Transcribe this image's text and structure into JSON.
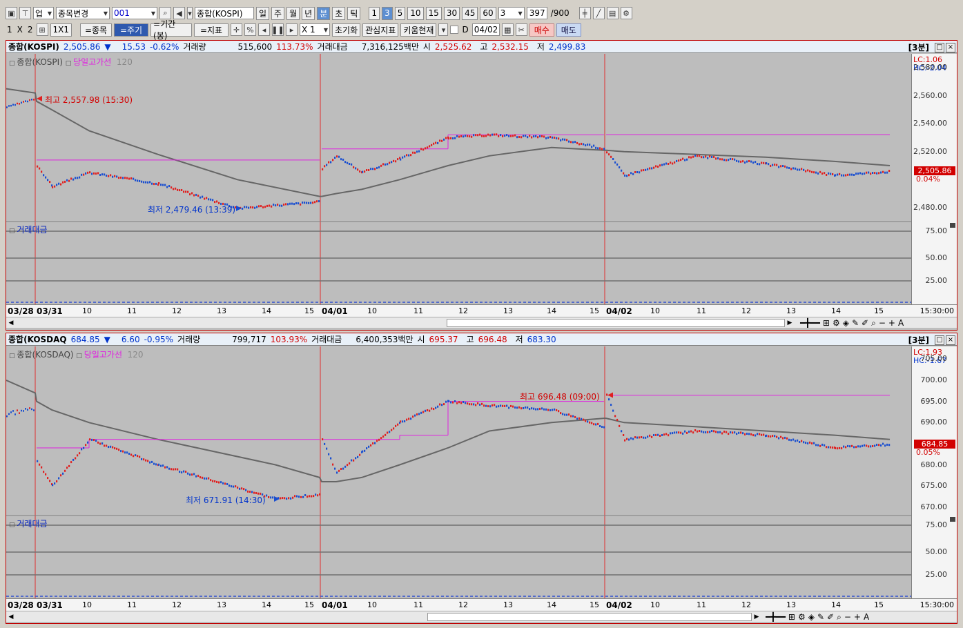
{
  "toolbar1": {
    "market": "업",
    "change_code": "종목변경",
    "code": "001",
    "symbol": "종합(KOSPI)",
    "period_day": "일",
    "period_week": "주",
    "period_month": "월",
    "period_year": "년",
    "period_min": "분",
    "period_sec": "초",
    "period_tick": "틱",
    "intervals": [
      "1",
      "3",
      "5",
      "10",
      "15",
      "30",
      "45",
      "60"
    ],
    "interval_value": "3",
    "count": "397",
    "count_total": "/900"
  },
  "toolbar2": {
    "layout_1": "1",
    "layout_x": "X",
    "layout_2": "2",
    "layout_1x1": "1X1",
    "btn_symbol": "=종목",
    "btn_period": "=주기",
    "btn_range": "=기간(봉)",
    "btn_indicator": "=지표",
    "pct": "%",
    "zoom": "X 1",
    "btn_reset": "초기화",
    "btn_watch": "관심지표",
    "btn_kiwoom": "키움현재",
    "d_label": "D",
    "date": "04/02",
    "btn_buy": "매수",
    "btn_sell": "매도"
  },
  "panels": [
    {
      "name": "종합(KOSPI)",
      "price": "2,505.86",
      "arrow": "▼",
      "change": "15.53",
      "change_pct": "-0.62%",
      "volume_label": "거래량",
      "volume": "515,600",
      "volume_pct": "113.73%",
      "amount_label": "거래대금",
      "amount": "7,316,125백만",
      "open_label": "시",
      "open": "2,525.62",
      "high_label": "고",
      "high": "2,532.15",
      "low_label": "저",
      "low": "2,499.83",
      "interval_tag": "[3분]",
      "legend_series": "종합(KOSPI)",
      "legend_line": "당일고가선",
      "legend_period": "120",
      "lc": "LC:1.06",
      "hc": "HC:-2.04",
      "y_ticks": [
        "2,580.00",
        "2,560.00",
        "2,540.00",
        "2,520.00",
        "2,480.00"
      ],
      "current_price": "2,505.86",
      "current_pct": "0.04%",
      "max_label": "최고 2,557.98 (15:30)",
      "min_label": "최저 2,479.46 (13:39)",
      "sub_title": "거래대금",
      "sub_ticks": [
        "75.00",
        "50.00",
        "25.00"
      ],
      "date_ticks": [
        "03/28",
        "03/31",
        "10",
        "11",
        "12",
        "13",
        "14",
        "15",
        "04/01",
        "10",
        "11",
        "12",
        "13",
        "14",
        "15",
        "04/02",
        "10",
        "11",
        "12",
        "13",
        "14",
        "15"
      ],
      "end_time": "15:30:00"
    },
    {
      "name": "종합(KOSDAQ",
      "price": "684.85",
      "arrow": "▼",
      "change": "6.60",
      "change_pct": "-0.95%",
      "volume_label": "거래량",
      "volume": "799,717",
      "volume_pct": "103.93%",
      "amount_label": "거래대금",
      "amount": "6,400,353백만",
      "open_label": "시",
      "open": "695.37",
      "high_label": "고",
      "high": "696.48",
      "low_label": "저",
      "low": "683.30",
      "interval_tag": "[3분]",
      "legend_series": "종합(KOSDAQ)",
      "legend_line": "당일고가선",
      "legend_period": "120",
      "lc": "LC:1.93",
      "hc": "HC:-1.67",
      "y_ticks": [
        "705.00",
        "700.00",
        "695.00",
        "690.00",
        "680.00",
        "675.00",
        "670.00"
      ],
      "current_price": "684.85",
      "current_pct": "0.05%",
      "max_label": "최고 696.48 (09:00)",
      "min_label": "최저 671.91 (14:30)",
      "sub_title": "거래대금",
      "sub_ticks": [
        "75.00",
        "50.00",
        "25.00"
      ],
      "date_ticks": [
        "03/28",
        "03/31",
        "10",
        "11",
        "12",
        "13",
        "14",
        "15",
        "04/01",
        "10",
        "11",
        "12",
        "13",
        "14",
        "15",
        "04/02",
        "10",
        "11",
        "12",
        "13",
        "14",
        "15"
      ],
      "end_time": "15:30:00"
    }
  ],
  "chart_data": [
    {
      "type": "line",
      "title": "종합(KOSPI)",
      "x": [
        "03/28 15:30",
        "03/31 09:00",
        "03/31 09:30",
        "03/31 10:30",
        "03/31 12:00",
        "03/31 13:39",
        "03/31 15:30",
        "04/01 09:00",
        "04/01 09:30",
        "04/01 10:00",
        "04/01 10:30",
        "04/01 11:30",
        "04/01 12:30",
        "04/01 14:00",
        "04/01 15:30",
        "04/02 09:00",
        "04/02 09:30",
        "04/02 11:00",
        "04/02 12:30",
        "04/02 14:00",
        "04/02 15:30"
      ],
      "series": [
        {
          "name": "종합(KOSPI)",
          "values": [
            2557.98,
            2510,
            2495,
            2505,
            2497,
            2479.46,
            2484,
            2508,
            2517,
            2505,
            2515,
            2530,
            2532,
            2530,
            2522,
            2520,
            2503,
            2517,
            2511,
            2503,
            2505.86
          ]
        },
        {
          "name": "당일고가선",
          "values": [
            null,
            2514,
            2514,
            2514,
            2514,
            2514,
            2514,
            2522,
            2522,
            2522,
            2522,
            2532,
            2532,
            2532,
            2532,
            2532.15,
            2532.15,
            2532.15,
            2532.15,
            2532.15,
            2532.15
          ]
        },
        {
          "name": "120",
          "values": [
            2562,
            2556,
            2550,
            2535,
            2518,
            2500,
            2488,
            2488,
            2490,
            2493,
            2500,
            2510,
            2517,
            2523,
            2521,
            2521,
            2520,
            2518,
            2516,
            2513,
            2510
          ]
        }
      ],
      "ylim": [
        2470,
        2590
      ],
      "grid": false
    },
    {
      "type": "line",
      "title": "종합(KOSDAQ)",
      "x": [
        "03/28 15:30",
        "03/31 09:00",
        "03/31 09:30",
        "03/31 10:30",
        "03/31 12:00",
        "03/31 14:30",
        "03/31 15:30",
        "04/01 09:00",
        "04/01 09:30",
        "04/01 10:00",
        "04/01 10:30",
        "04/01 11:30",
        "04/01 12:30",
        "04/01 14:00",
        "04/01 15:30",
        "04/02 09:00",
        "04/02 09:30",
        "04/02 11:00",
        "04/02 12:30",
        "04/02 14:00",
        "04/02 15:30"
      ],
      "series": [
        {
          "name": "종합(KOSDAQ)",
          "values": [
            693.5,
            681,
            675,
            686,
            680,
            671.91,
            673,
            686,
            678,
            683,
            690,
            695,
            694,
            693,
            689,
            696.48,
            686,
            688,
            687,
            684,
            684.85
          ]
        },
        {
          "name": "당일고가선",
          "values": [
            null,
            684,
            684,
            686,
            686,
            686,
            686,
            686,
            686,
            686,
            687,
            695,
            695,
            695,
            695,
            696.48,
            696.48,
            696.48,
            696.48,
            696.48,
            696.48
          ]
        },
        {
          "name": "120",
          "values": [
            697,
            695,
            693,
            690,
            686,
            680,
            677,
            676,
            676,
            677,
            680,
            684,
            688,
            690,
            691,
            691,
            690,
            689,
            688,
            687,
            686
          ]
        }
      ],
      "ylim": [
        668,
        708
      ],
      "grid": false
    }
  ]
}
